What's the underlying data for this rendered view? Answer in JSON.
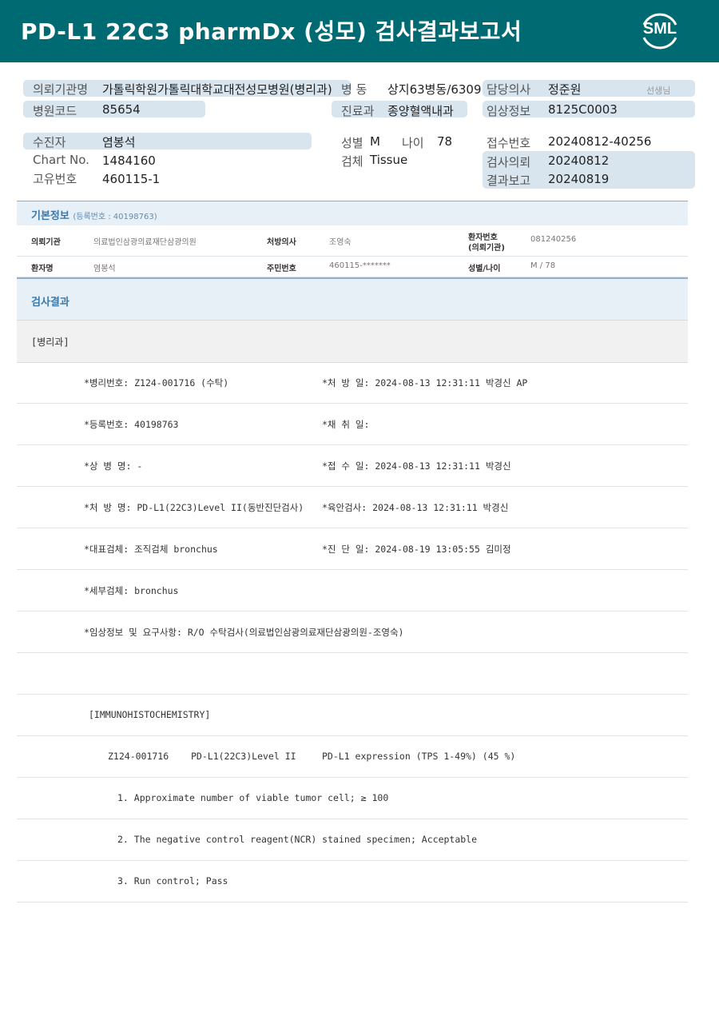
{
  "header": {
    "title": "PD-L1 22C3 pharmDx (성모) 검사결과보고서",
    "logo_text": "SML"
  },
  "patient_block": {
    "institution_label": "의뢰기관명",
    "institution_value": "가톨릭학원가톨릭대학교대전성모병원(병리과)",
    "ward_label": "병 동",
    "ward_value": "상지63병동/6309",
    "doctor_label": "담당의사",
    "doctor_value": "정준원",
    "doctor_suffix": "선생님",
    "hospital_code_label": "병원코드",
    "hospital_code_value": "85654",
    "dept_label": "진료과",
    "dept_value": "종양혈액내과",
    "clinical_info_label": "임상정보",
    "clinical_info_value": "8125C0003",
    "patient_label": "수진자",
    "patient_value": "염봉석",
    "chart_label": "Chart No.",
    "chart_value": "1484160",
    "unique_label": "고유번호",
    "unique_value": "460115-1",
    "sex_label": "성별",
    "sex_value": "M",
    "age_label": "나이",
    "age_value": "78",
    "specimen_label": "검체",
    "specimen_value": "Tissue",
    "receipt_label": "접수번호",
    "receipt_value": "20240812-40256",
    "request_label": "검사의뢰",
    "request_value": "20240812",
    "report_label": "결과보고",
    "report_value": "20240819"
  },
  "basic_info": {
    "title": "기본정보",
    "subtitle": "(등록번호 : 40198763)",
    "row1": {
      "k1": "의뢰기관",
      "v1": "의료법인삼광의료재단삼광의원",
      "k2": "처방의사",
      "v2": "조영숙",
      "k3a": "환자번호",
      "k3b": "(의뢰기관)",
      "v3": "081240256"
    },
    "row2": {
      "k1": "환자명",
      "v1": "염봉석",
      "k2": "주민번호",
      "v2": "460115-*******",
      "k3": "성별/나이",
      "v3": "M / 78"
    }
  },
  "results": {
    "title": "검사결과",
    "dept": "[병리과]",
    "rows": [
      {
        "left": "*병리번호: Z124-001716 (수탁)",
        "right": "*처 방 일: 2024-08-13 12:31:11  박경신 AP"
      },
      {
        "left": "*등록번호: 40198763",
        "right": "*채 취 일:"
      },
      {
        "left": "*상 병 명: -",
        "right": "*접 수 일: 2024-08-13 12:31:11  박경신"
      },
      {
        "left": "*처 방 명: PD-L1(22C3)Level II(동반진단검사)",
        "right": "*육안검사: 2024-08-13 12:31:11  박경신"
      },
      {
        "left": "*대표검체: 조직검체 bronchus",
        "right": "*진 단 일: 2024-08-19 13:05:55  김미정"
      },
      {
        "left": "*세부검체: bronchus",
        "right": ""
      },
      {
        "left": "*임상정보 및 요구사항: R/O 수탁검사(의료법인삼광의료재단삼광의원-조영숙)",
        "right": ""
      },
      {
        "left": "",
        "right": ""
      },
      {
        "left": "[IMMUNOHISTOCHEMISTRY]",
        "right": ""
      }
    ],
    "ihc": {
      "case": "Z124-001716",
      "test": "PD-L1(22C3)Level II",
      "result": "PD-L1 expression (TPS 1-49%) (45 %)"
    },
    "notes": [
      "1. Approximate number of viable tumor cell; ≥ 100",
      "2. The negative control reagent(NCR) stained specimen; Acceptable",
      "3. Run control; Pass"
    ]
  }
}
